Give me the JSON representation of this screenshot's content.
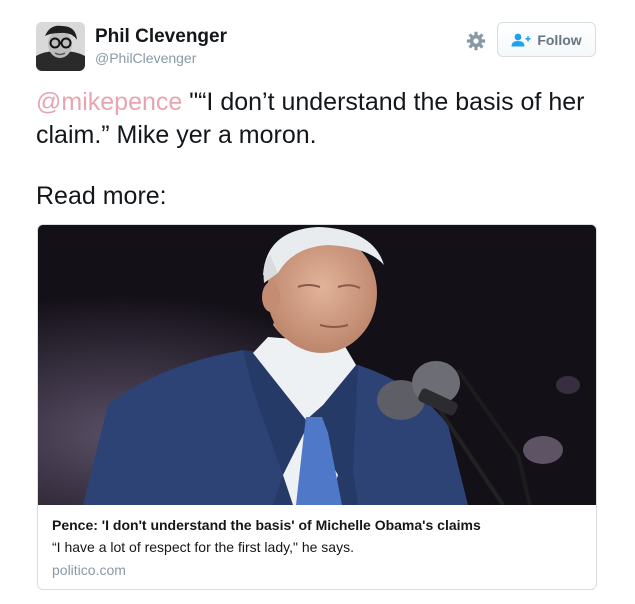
{
  "user": {
    "display_name": "Phil Clevenger",
    "handle": "@PhilClevenger",
    "avatar_icon": "profile-photo"
  },
  "actions": {
    "settings_icon": "gear-icon",
    "follow_label": "Follow",
    "follow_icon": "add-user-icon"
  },
  "tweet": {
    "mention": "@mikepence",
    "text_rest": " \"“I don’t understand the basis of her claim.” Mike yer a moron.",
    "read_more": "Read more:"
  },
  "card": {
    "title": "Pence: 'I don't understand the basis' of Michelle Obama's claims",
    "description": "“I have a lot of respect for the first lady,\" he says.",
    "domain": "politico.com"
  },
  "colors": {
    "mention": "#e8a5b0",
    "secondary_text": "#8899a6",
    "suit": "#2d4275",
    "tie": "#4f78c9"
  }
}
